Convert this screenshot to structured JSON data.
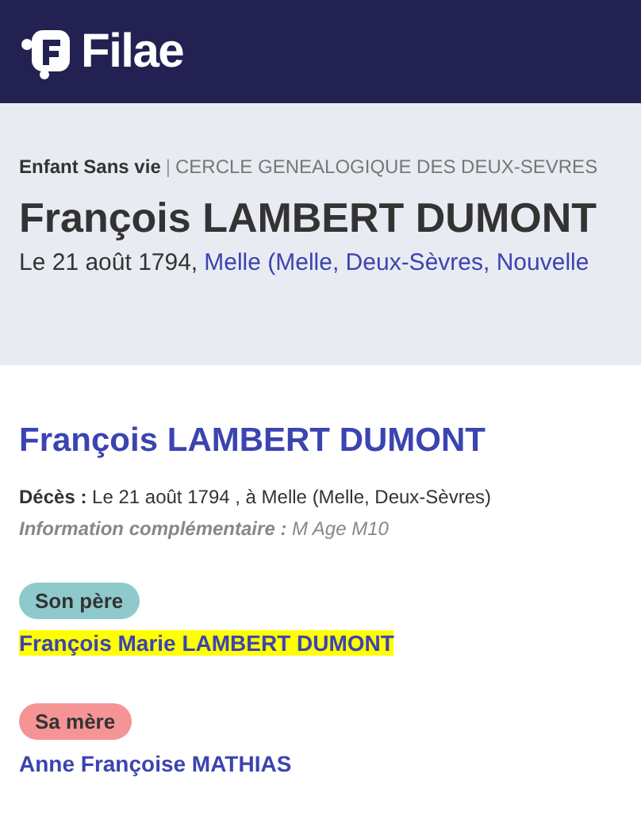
{
  "header": {
    "logo_text": "Filae"
  },
  "banner": {
    "collection": "Enfant Sans vie",
    "separator": "|",
    "source": "CERCLE GENEALOGIQUE DES DEUX-SEVRES",
    "title": "François LAMBERT DUMONT",
    "date": "Le 21 août 1794,",
    "place": "Melle (Melle, Deux-Sèvres, Nouvelle"
  },
  "record": {
    "name": "François LAMBERT DUMONT",
    "death_label": "Décès :",
    "death_value": "Le 21 août 1794 , à Melle (Melle, Deux-Sèvres)",
    "info_label": "Information complémentaire :",
    "info_value": "M Age M10",
    "parents": [
      {
        "role": "Son père",
        "color": "#8ecacb",
        "name": "François Marie LAMBERT DUMONT",
        "highlighted": true
      },
      {
        "role": "Sa mère",
        "color": "#f49494",
        "name": "Anne Françoise MATHIAS",
        "highlighted": false
      }
    ]
  }
}
